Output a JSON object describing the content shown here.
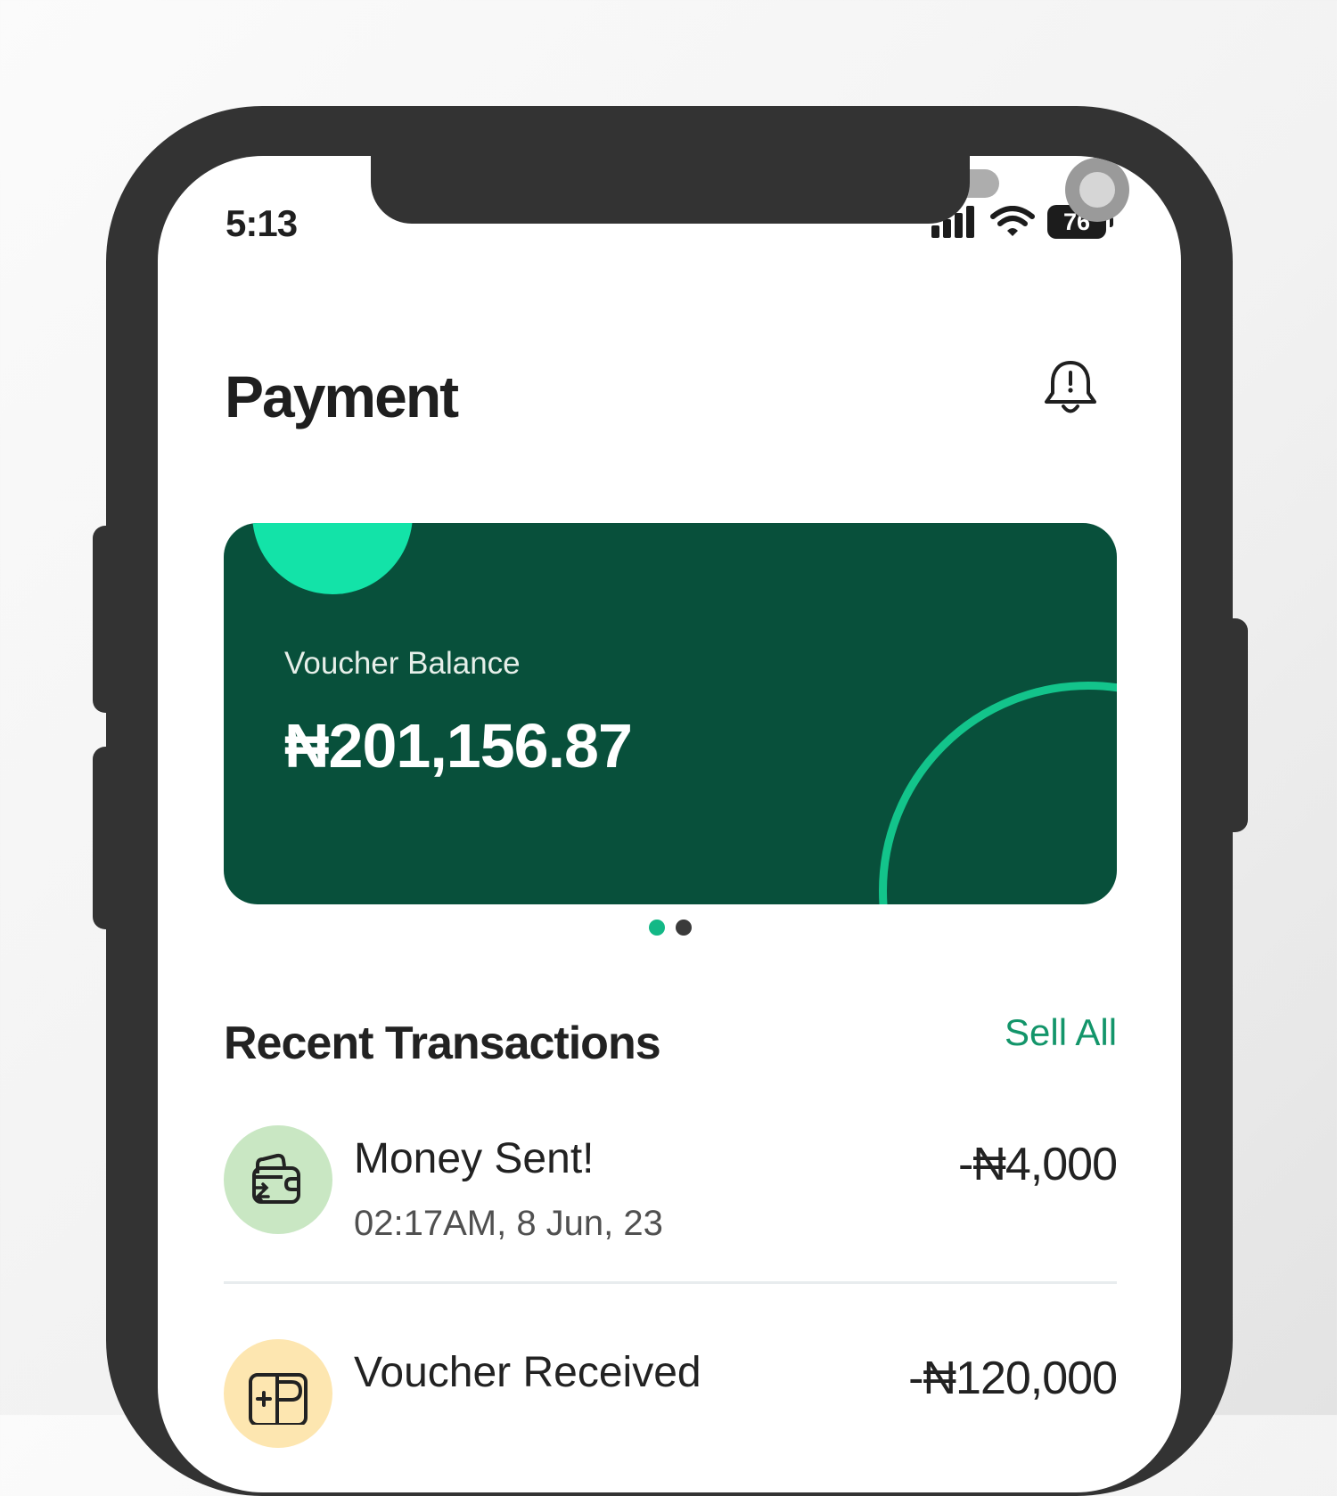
{
  "status_bar": {
    "time": "5:13",
    "battery": "76"
  },
  "header": {
    "title": "Payment",
    "notification_icon": "bell-icon"
  },
  "balance_card": {
    "label": "Voucher Balance",
    "amount": "₦201,156.87",
    "background": "#08503b",
    "accent": "#13e3a8"
  },
  "pagination": {
    "pages": 2,
    "active": 1
  },
  "recent": {
    "title": "Recent Transactions",
    "see_all_label": "Sell All",
    "items": [
      {
        "title": "Money Sent!",
        "time": "02:17AM, 8 Jun, 23",
        "amount": "-₦4,000",
        "icon": "wallet-transfer-icon",
        "icon_bg": "#c9e7c3"
      },
      {
        "title": "Voucher Received",
        "amount": "-₦120,000",
        "icon": "voucher-add-icon",
        "icon_bg": "#fde6b0"
      }
    ]
  }
}
